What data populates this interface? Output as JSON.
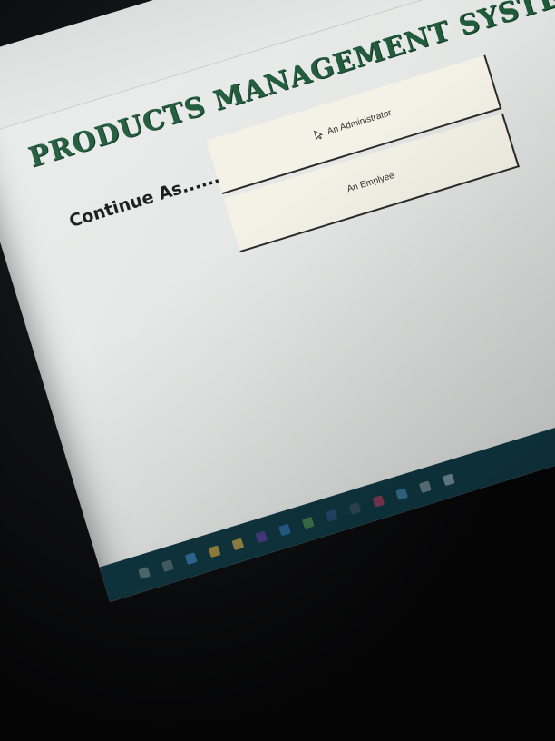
{
  "app": {
    "title": "PRODUCTS MANAGEMENT SYSTEM"
  },
  "main": {
    "prompt": "Continue As........................",
    "buttons": [
      {
        "label": "An Administrator"
      },
      {
        "label": "An Emplyee"
      }
    ]
  },
  "colors": {
    "title": "#1f5a3a",
    "button_bg": "#f4f1e6",
    "screen_bg": "#e6e9e7",
    "taskbar": "#0f3640"
  },
  "taskbar": {
    "icons": [
      "search-icon",
      "task-view-icon",
      "edge-icon",
      "chrome-icon",
      "file-explorer-icon",
      "visual-studio-icon",
      "store-icon",
      "app-icon",
      "app-icon-2",
      "folder-icon",
      "app-icon-3",
      "app-icon-4",
      "app-icon-5",
      "app-icon-6"
    ]
  }
}
